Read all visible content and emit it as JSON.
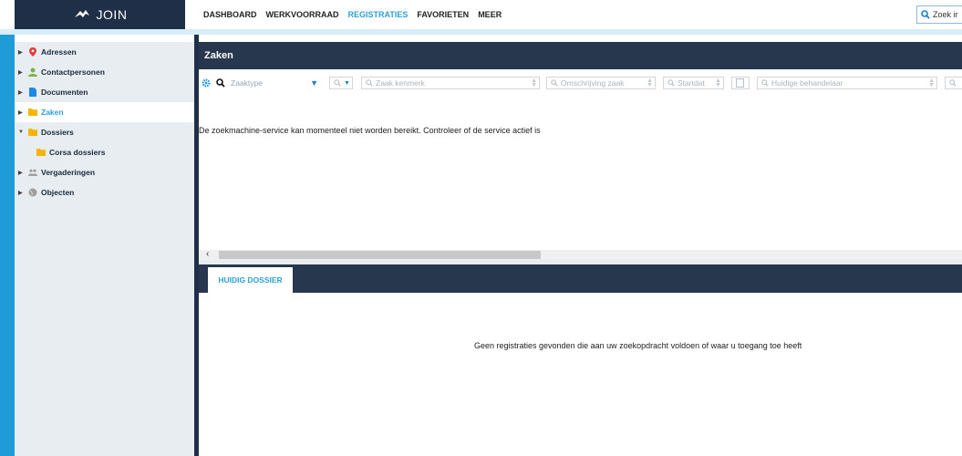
{
  "brand": {
    "name": "JOIN"
  },
  "nav": {
    "items": [
      "DASHBOARD",
      "WERKVOORRAAD",
      "REGISTRATIES",
      "FAVORIETEN",
      "MEER"
    ],
    "active": "REGISTRATIES"
  },
  "search": {
    "placeholder": "Zoek ir"
  },
  "sidebar": {
    "items": [
      {
        "label": "Adressen",
        "icon": "map-pin-icon",
        "color": "#e53935"
      },
      {
        "label": "Contactpersonen",
        "icon": "person-icon",
        "color": "#7cb342"
      },
      {
        "label": "Documenten",
        "icon": "document-icon",
        "color": "#1e88e5"
      },
      {
        "label": "Zaken",
        "icon": "folder-icon",
        "color": "#f5b400"
      },
      {
        "label": "Dossiers",
        "icon": "folder-icon",
        "color": "#f5b400"
      },
      {
        "label": "Corsa dossiers",
        "icon": "folder-icon",
        "color": "#f5b400"
      },
      {
        "label": "Vergaderingen",
        "icon": "people-icon",
        "color": "#9e9e9e"
      },
      {
        "label": "Objecten",
        "icon": "globe-icon",
        "color": "#9e9e9e"
      }
    ]
  },
  "main": {
    "title": "Zaken",
    "filters": {
      "zaaktype": "Zaaktype",
      "zaak_kenmerk": "Zaak kenmerk",
      "omschrijving": "Omschrijving zaak",
      "startdat": "Startdat",
      "behandelaar": "Huidige behandelaar"
    },
    "message": "De zoekmachine-service kan momenteel niet worden bereikt. Controleer of de service actief is"
  },
  "panel": {
    "tab": "HUIDIG DOSSIER",
    "empty": "Geen registraties gevonden die aan uw zoekopdracht voldoen of waar u toegang toe heeft"
  },
  "colors": {
    "accent": "#2fa0d8",
    "dark": "#27374d",
    "sidebar_bg": "#e8edf2"
  }
}
